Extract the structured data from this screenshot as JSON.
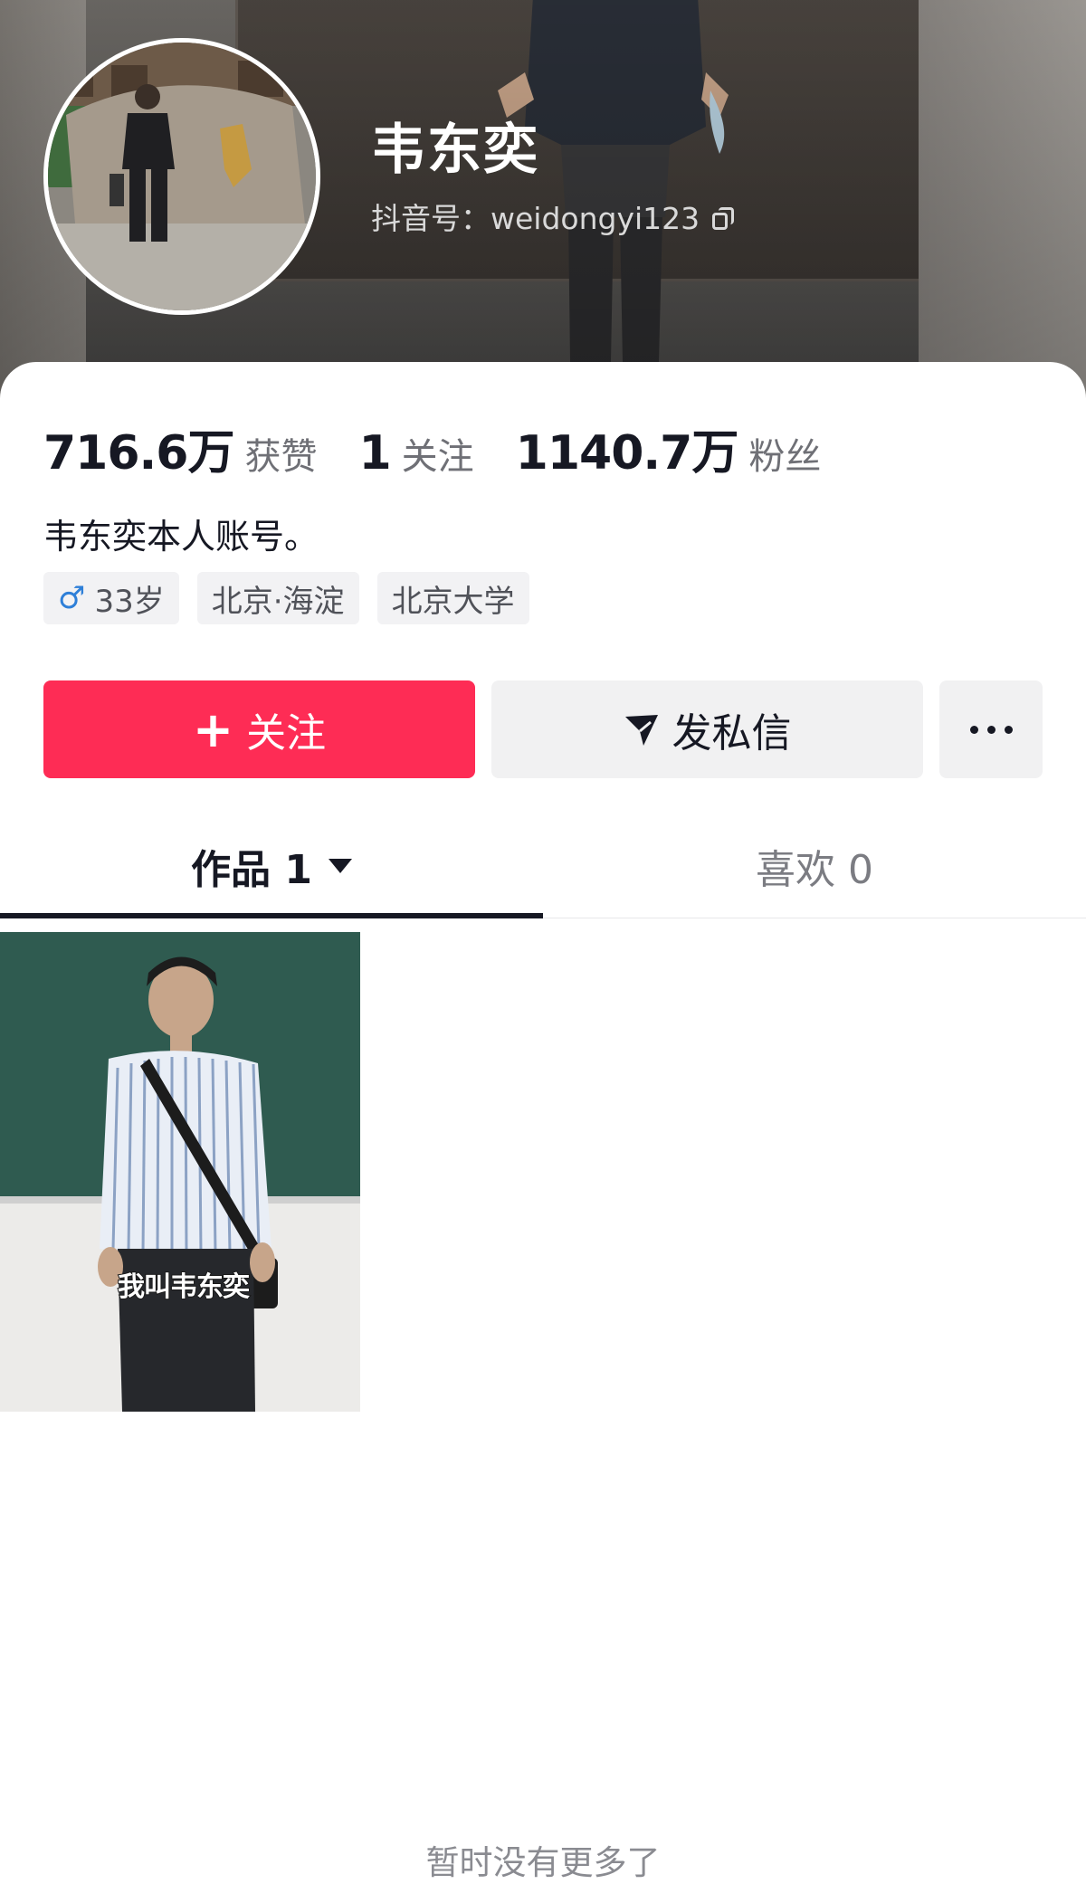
{
  "profile": {
    "name": "韦东奕",
    "handle": "抖音号：weidongyi123",
    "bio": "韦东奕本人账号。"
  },
  "stats": [
    {
      "value": "716.6万",
      "label": "获赞"
    },
    {
      "value": "1",
      "label": "关注"
    },
    {
      "value": "1140.7万",
      "label": "粉丝"
    }
  ],
  "tags": {
    "gender_icon": "♂",
    "age": "33岁",
    "location": "北京·海淀",
    "school": "北京大学"
  },
  "actions": {
    "follow_icon": "+",
    "follow_label": "关注",
    "message_label": "发私信",
    "more_icon": "more-dots-icon"
  },
  "tabs": [
    {
      "label": "作品 1",
      "active": true
    },
    {
      "label": "喜欢 0",
      "active": false
    }
  ],
  "videos": [
    {
      "caption": "我叫韦东奕"
    }
  ],
  "footer": {
    "no_more": "暂时没有更多了"
  },
  "colors": {
    "accent": "#fe2c55",
    "male": "#2e7fd8"
  }
}
